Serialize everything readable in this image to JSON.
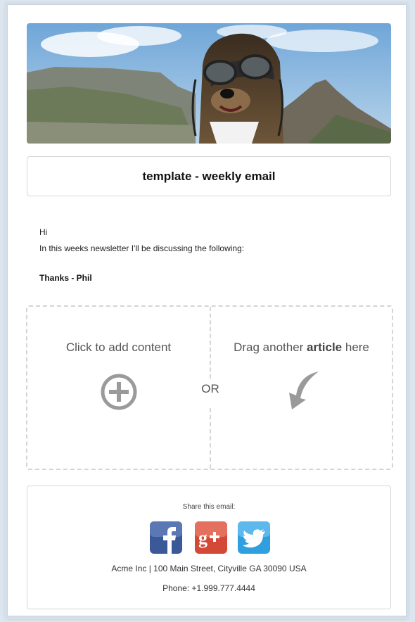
{
  "email": {
    "hero_image": "dog-with-goggles-mountain-photo",
    "title": "template - weekly email",
    "greeting": "Hi",
    "intro": "In this weeks newsletter I'll be discussing the following:",
    "signoff": "Thanks - Phil"
  },
  "dropzone": {
    "add_label": "Click to add content",
    "or_label": "OR",
    "drag_prefix": "Drag another ",
    "drag_bold": "article",
    "drag_suffix": " here",
    "add_icon": "plus-circle-icon",
    "arrow_icon": "curved-arrow-icon"
  },
  "footer": {
    "share_label": "Share this email:",
    "networks": [
      "facebook",
      "google-plus",
      "twitter"
    ],
    "address": "Acme Inc | 100 Main Street, Cityville GA 30090 USA",
    "phone": "Phone: +1.999.777.4444"
  },
  "colors": {
    "facebook": "#3b5998",
    "google_plus": "#d34836",
    "twitter": "#2f9fe0",
    "icon_gray": "#9a9a9a"
  }
}
